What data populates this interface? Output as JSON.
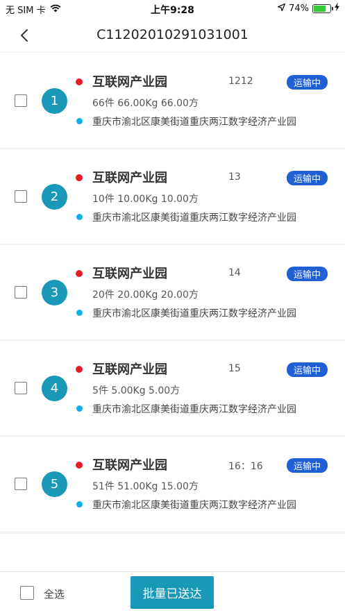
{
  "status_bar": {
    "carrier": "无 SIM 卡",
    "time": "上午9:28",
    "battery_percent": "74%",
    "battery_level": 0.74
  },
  "nav": {
    "title": "C11202010291031001"
  },
  "orders": [
    {
      "index": "1",
      "name": "互联网产业园",
      "code": "1212",
      "status": "运输中",
      "details": "66件 66.00Kg 66.00方",
      "address": "重庆市渝北区康美街道重庆两江数字经济产业园"
    },
    {
      "index": "2",
      "name": "互联网产业园",
      "code": "13",
      "status": "运输中",
      "details": "10件 10.00Kg 10.00方",
      "address": "重庆市渝北区康美街道重庆两江数字经济产业园"
    },
    {
      "index": "3",
      "name": "互联网产业园",
      "code": "14",
      "status": "运输中",
      "details": "20件 20.00Kg 20.00方",
      "address": "重庆市渝北区康美街道重庆两江数字经济产业园"
    },
    {
      "index": "4",
      "name": "互联网产业园",
      "code": "15",
      "status": "运输中",
      "details": "5件 5.00Kg 5.00方",
      "address": "重庆市渝北区康美街道重庆两江数字经济产业园"
    },
    {
      "index": "5",
      "name": "互联网产业园",
      "code": "16：16",
      "status": "运输中",
      "details": "51件 51.00Kg 15.00方",
      "address": "重庆市渝北区康美街道重庆两江数字经济产业园"
    }
  ],
  "footer": {
    "select_all_label": "全选",
    "batch_button_label": "批量已送达"
  },
  "colors": {
    "primary": "#1a98b7",
    "badge": "#2060d6",
    "red_dot": "#e51c23",
    "blue_dot": "#0fb0e6",
    "battery": "#38c93b"
  }
}
